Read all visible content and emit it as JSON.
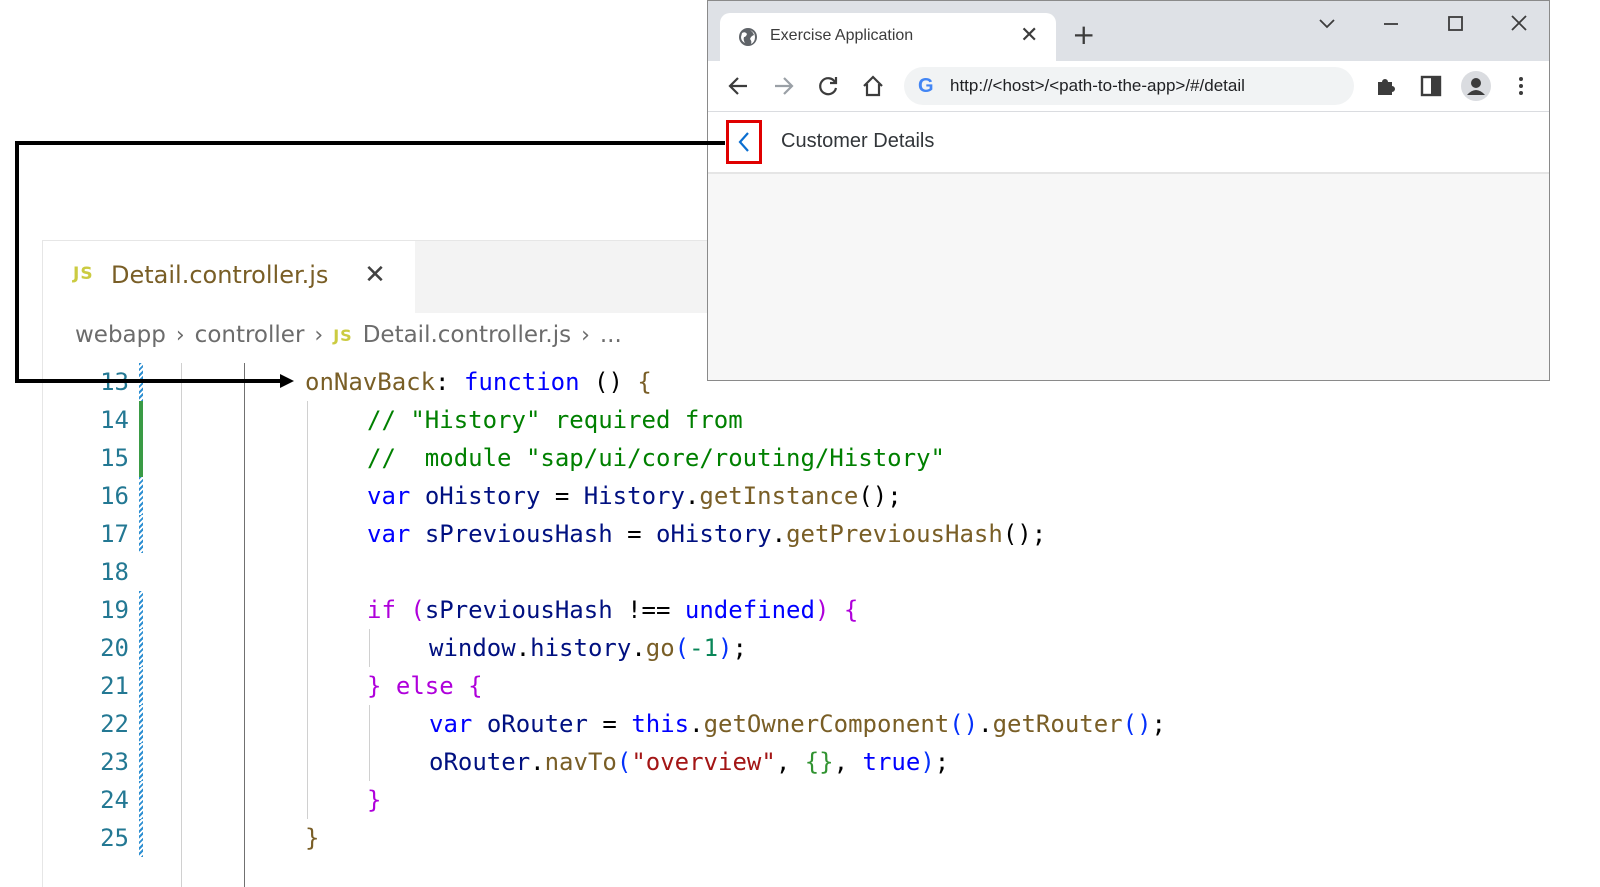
{
  "editor": {
    "tab": {
      "icon": "JS",
      "title": "Detail.controller.js",
      "close": "✕"
    },
    "breadcrumb": {
      "part1": "webapp",
      "sep": "›",
      "part2": "controller",
      "icon": "JS",
      "part3": "Detail.controller.js",
      "more": "..."
    },
    "lines": [
      {
        "n": "13"
      },
      {
        "n": "14"
      },
      {
        "n": "15"
      },
      {
        "n": "16"
      },
      {
        "n": "17"
      },
      {
        "n": "18"
      },
      {
        "n": "19"
      },
      {
        "n": "20"
      },
      {
        "n": "21"
      },
      {
        "n": "22"
      },
      {
        "n": "23"
      },
      {
        "n": "24"
      },
      {
        "n": "25"
      }
    ],
    "code": {
      "l13": {
        "a": "onNavBack",
        "b": ": ",
        "c": "function",
        "d": " () ",
        "e": "{"
      },
      "l14": {
        "a": "// \"History\" required from"
      },
      "l15": {
        "a": "//  module \"sap/ui/core/routing/History\""
      },
      "l16": {
        "a": "var",
        "b": " ",
        "c": "oHistory",
        "d": " = ",
        "e": "History",
        "f": ".",
        "g": "getInstance",
        "h": "();"
      },
      "l17": {
        "a": "var",
        "b": " ",
        "c": "sPreviousHash",
        "d": " = ",
        "e": "oHistory",
        "f": ".",
        "g": "getPreviousHash",
        "h": "();"
      },
      "l19": {
        "a": "if",
        "b": " ",
        "c": "(",
        "d": "sPreviousHash",
        "e": " !== ",
        "f": "undefined",
        "g": ")",
        "h": " {"
      },
      "l20": {
        "a": "window",
        "b": ".",
        "c": "history",
        "d": ".",
        "e": "go",
        "f": "(",
        "g": "-1",
        "h": ")",
        "i": ";"
      },
      "l21": {
        "a": "}",
        "b": " ",
        "c": "else",
        "d": " {"
      },
      "l22": {
        "a": "var",
        "b": " ",
        "c": "oRouter",
        "d": " = ",
        "e": "this",
        "f": ".",
        "g": "getOwnerComponent",
        "h": "()",
        "i": ".",
        "j": "getRouter",
        "k": "()",
        "l": ";"
      },
      "l23": {
        "a": "oRouter",
        "b": ".",
        "c": "navTo",
        "d": "(",
        "e": "\"overview\"",
        "f": ", ",
        "g": "{}",
        "h": ", ",
        "i": "true",
        "j": ")",
        "k": ";"
      },
      "l24": {
        "a": "}"
      },
      "l25": {
        "a": "}"
      }
    }
  },
  "browser": {
    "tab_title": "Exercise Application",
    "tab_close": "✕",
    "new_tab": "+",
    "url": "http://<host>/<path-to-the-app>/#/detail",
    "page_title": "Customer Details"
  },
  "icons": [
    "globe-icon",
    "close-icon",
    "plus-icon",
    "chevron-down-icon",
    "minimize-icon",
    "maximize-icon",
    "window-close-icon",
    "back-arrow-icon",
    "forward-arrow-icon",
    "reload-icon",
    "home-icon",
    "google-icon",
    "extensions-icon",
    "side-panel-icon",
    "profile-icon",
    "menu-dots-icon",
    "nav-back-chevron-icon"
  ],
  "colors": {
    "highlight_box": "#e00000",
    "nav_back": "#0a6ed1",
    "accent_blue": "#0000ff"
  }
}
